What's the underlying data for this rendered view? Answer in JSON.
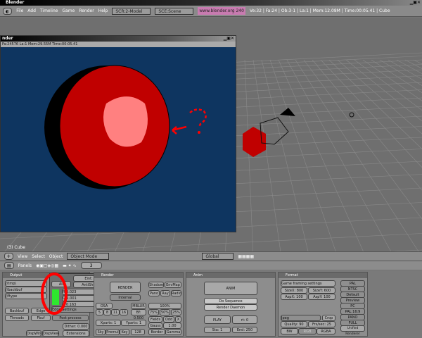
{
  "window": {
    "title": "Blender"
  },
  "menubar": {
    "menus": [
      "File",
      "Add",
      "Timeline",
      "Game",
      "Render",
      "Help"
    ],
    "screen": "SCR:2-Model",
    "scene": "SCE:Scene",
    "url": "www.blender.org 240",
    "stats": "Ve:32 | Fa:24 | Ob:3-1 | La:1 | Mem:12.08M | Time:00:05.41 | Cube"
  },
  "render_window": {
    "title": "nder",
    "info": "Fa:24576 La:1 Mem:29.55M Time:00:05.41"
  },
  "viewport": {
    "object_label": "(3) Cube"
  },
  "view3d_header": {
    "menus": [
      "View",
      "Select",
      "Object"
    ],
    "mode": "Object Mode",
    "orientation": "Global"
  },
  "buttons_header": {
    "panels_label": "Panels",
    "frame": "3"
  },
  "output": {
    "title": "Output",
    "paths": [
      "//tmp\\",
      "//backbuf",
      "//ftype"
    ],
    "backbuf": "Backbuf",
    "edge": "Edge",
    "edge_settings": "Edge Settings",
    "threads": "Threads",
    "fbuf": "Fbuf",
    "post_process": "Post process",
    "dither": "Dither: 0.000",
    "extensions": "Extensions",
    "disp_win": "DispWin",
    "disp_view": "DispView"
  },
  "popup": {
    "all": "All",
    "eint": "Eint: 10",
    "antishift": "AntiShift: 0",
    "r": "R 0.023",
    "g": "G 1.001",
    "b": "B 0.163",
    "color": "#2ee82e"
  },
  "render": {
    "title": "Render",
    "button": "RENDER",
    "renderer": "Internal",
    "shadow": "Shadow",
    "envmap": "EnvMap",
    "pano": "Pano",
    "ray": "Ray",
    "radio": "Radio",
    "osa": "OSA",
    "mblur": "MBLUR",
    "bf": "Bf: 0.500",
    "osa_levels": [
      "5",
      "8",
      "11",
      "16"
    ],
    "pct": "100%",
    "pcts": [
      "75%",
      "50%",
      "25%"
    ],
    "xparts": "Xparts: 1",
    "yparts": "Yparts: 1",
    "fields": "Fields",
    "odd": "Odd",
    "x": "X",
    "gauss": "Gauss",
    "gauss_val": "1.00",
    "sky": "Sky",
    "premul": "Premul",
    "key": "Key",
    "depth": "128",
    "border": "Border",
    "gamma": "Gamma"
  },
  "anim": {
    "title": "Anim",
    "anim": "ANIM",
    "do_sequence": "Do Sequence",
    "render_daemon": "Render Daemon",
    "play": "PLAY",
    "rt": "rt: 0",
    "sta": "Sta: 1",
    "end": "End: 250"
  },
  "format": {
    "title": "Format",
    "game_framing": "Game framing settings",
    "sizex": "SizeX: 800",
    "sizey": "SizeY: 600",
    "aspx": "AspX: 100",
    "aspy": "AspY: 100",
    "filetype": "Jpeg",
    "crop": "Crop",
    "quality": "Quality: 90",
    "frs": "Frs/sec: 25",
    "bw": "BW",
    "rgb": "RGB",
    "rgba": "RGBA",
    "presets": [
      "PAL",
      "NTSC",
      "Default",
      "Preview",
      "PC",
      "PAL 16:9",
      "PANO",
      "FULL",
      "Unified Renderer"
    ]
  },
  "colors": {
    "sphere": "#c00000",
    "highlight": "#ff8080",
    "render_bg": "#0e3560",
    "annotation": "#ff0000"
  }
}
